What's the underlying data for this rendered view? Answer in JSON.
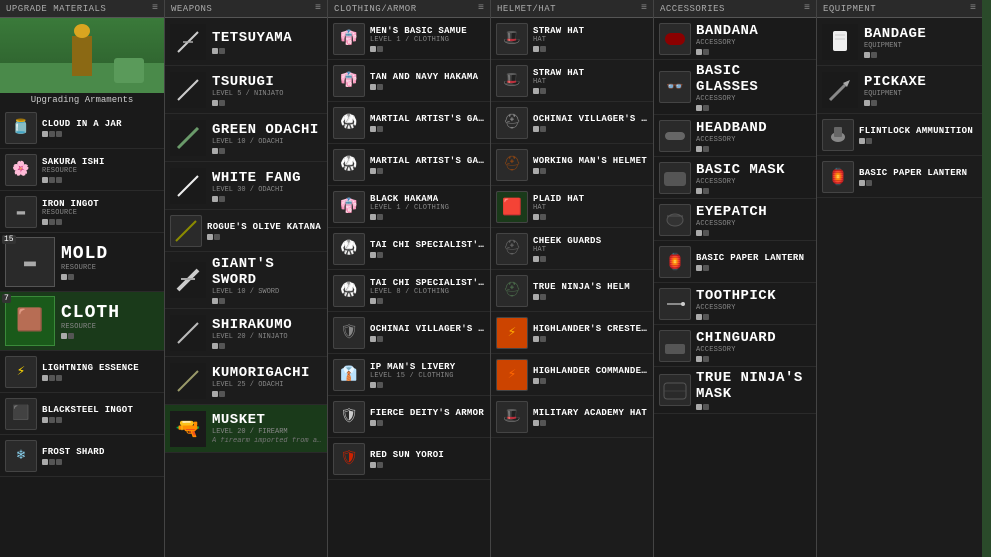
{
  "columns": {
    "upgrade": {
      "header": "UPGRADE MATERIALS",
      "preview_label": "Upgrading Armaments",
      "items": [
        {
          "name": "CLOUD IN A JAR",
          "sub": "",
          "icon": "🫙",
          "stars": 2,
          "num": "",
          "color": "ico-jar"
        },
        {
          "name": "SAKURA ISHI",
          "sub": "RESOURCE",
          "icon": "🌸",
          "stars": 2,
          "num": "",
          "color": "ico-sakura"
        },
        {
          "name": "IRON INGOT",
          "sub": "RESOURCE",
          "icon": "⬛",
          "stars": 2,
          "num": "",
          "color": "ico-iron"
        },
        {
          "name": "MOLD",
          "sub": "RESOURCE",
          "icon": "▬",
          "stars": 2,
          "num": "15",
          "color": "ico-mold",
          "big": true
        },
        {
          "name": "CLOTH",
          "sub": "RESOURCE",
          "icon": "🟫",
          "stars": 2,
          "num": "7",
          "color": "ico-cloth",
          "big": true
        },
        {
          "name": "LIGHTNING ESSENCE",
          "sub": "",
          "icon": "⚡",
          "stars": 2,
          "num": "",
          "color": "ico-lightning"
        },
        {
          "name": "BLACKSTEEL INGOT",
          "sub": "",
          "icon": "⬛",
          "stars": 2,
          "num": "",
          "color": "ico-blacksteel"
        },
        {
          "name": "FROST SHARD",
          "sub": "",
          "icon": "❄",
          "stars": 2,
          "num": "",
          "color": "ico-frost"
        }
      ]
    },
    "weapons": {
      "header": "WEAPONS",
      "items": [
        {
          "name": "TETSUYAMA",
          "sub": "",
          "level": "",
          "icon": "⚔",
          "stars": 2
        },
        {
          "name": "TSURUGI",
          "sub": "LEVEL 5 / NINJATO",
          "icon": "⚔",
          "stars": 2
        },
        {
          "name": "GREEN ODACHI",
          "sub": "LEVEL 10 / ODACHI",
          "icon": "🗡",
          "stars": 2
        },
        {
          "name": "WHITE FANG",
          "sub": "LEVEL 30 / ODACHI",
          "icon": "⚔",
          "stars": 2
        },
        {
          "name": "ROGUE'S OLIVE KATANA",
          "sub": "",
          "icon": "🗡",
          "stars": 2
        },
        {
          "name": "GIANT'S SWORD",
          "sub": "LEVEL 10 / SWORD",
          "icon": "⚔",
          "stars": 2
        },
        {
          "name": "SHIRAKUMO",
          "sub": "LEVEL 20 / NINJATO",
          "icon": "⚔",
          "stars": 2
        },
        {
          "name": "KUMORIGACHI",
          "sub": "LEVEL 25 / ODACHI",
          "icon": "⚔",
          "stars": 2
        },
        {
          "name": "MUSKET",
          "sub": "LEVEL 20 / FIREARM",
          "desc": "A firearm imported from a far away land.",
          "icon": "🔫",
          "stars": 2,
          "green": true
        }
      ]
    },
    "clothing": {
      "header": "CLOTHING/ARMOR",
      "items": [
        {
          "name": "MEN'S BASIC SAMUE",
          "sub": "LEVEL 1 / CLOTHING",
          "icon": "👘",
          "stars": 2
        },
        {
          "name": "TAN AND NAVY HAKAMA",
          "sub": "",
          "icon": "👘",
          "stars": 2
        },
        {
          "name": "MARTIAL ARTIST'S GARB(BLACK)",
          "sub": "",
          "icon": "🥋",
          "stars": 2
        },
        {
          "name": "MARTIAL ARTIST'S GARB(NAVY)",
          "sub": "",
          "icon": "🥋",
          "stars": 2
        },
        {
          "name": "BLACK HAKAMA",
          "sub": "LEVEL 1 / CLOTHING",
          "icon": "👘",
          "stars": 2
        },
        {
          "name": "TAI CHI SPECIALIST'S JACKET",
          "sub": "",
          "icon": "🥋",
          "stars": 2
        },
        {
          "name": "TAI CHI SPECIALIST'S JACKET(BLACK)",
          "sub": "LEVEL 8 / CLOTHING",
          "icon": "🥋",
          "stars": 2
        },
        {
          "name": "OCHINAI VILLAGER'S ARMOR",
          "sub": "",
          "icon": "🛡",
          "stars": 2
        },
        {
          "name": "IP MAN'S LIVERY",
          "sub": "LEVEL 15 / CLOTHING",
          "icon": "👔",
          "stars": 2
        },
        {
          "name": "FIERCE DEITY'S ARMOR",
          "sub": "",
          "icon": "🛡",
          "stars": 2
        },
        {
          "name": "RED SUN YOROI",
          "sub": "",
          "icon": "🛡",
          "stars": 2
        }
      ]
    },
    "helmet": {
      "header": "HELMET/HAT",
      "items": [
        {
          "name": "STRAW HAT",
          "sub": "HAT",
          "icon": "🎩",
          "stars": 2
        },
        {
          "name": "STRAW HAT",
          "sub": "HAT",
          "icon": "🎩",
          "stars": 2
        },
        {
          "name": "OCHINAI VILLAGER'S HELMET",
          "sub": "",
          "icon": "⛑",
          "stars": 2
        },
        {
          "name": "WORKING MAN'S HELMET",
          "sub": "",
          "icon": "⛑",
          "stars": 2
        },
        {
          "name": "PLAID HAT",
          "sub": "HAT",
          "icon": "🎩",
          "stars": 2
        },
        {
          "name": "CHEEK GUARDS",
          "sub": "HAT",
          "icon": "⛑",
          "stars": 2
        },
        {
          "name": "TRUE NINJA'S HELM",
          "sub": "",
          "icon": "⛑",
          "stars": 2
        },
        {
          "name": "HIGHLANDER'S CRESTED HELM",
          "sub": "",
          "icon": "⛑",
          "stars": 2
        },
        {
          "name": "HIGHLANDER COMMANDER'S CRESTED HELM",
          "sub": "",
          "icon": "⛑",
          "stars": 2
        },
        {
          "name": "MILITARY ACADEMY HAT",
          "sub": "",
          "icon": "🎩",
          "stars": 2
        }
      ]
    },
    "accessories": {
      "header": "ACCESSORIES",
      "items": [
        {
          "name": "BANDANA",
          "sub": "ACCESSORY",
          "icon": "🎀",
          "stars": 2
        },
        {
          "name": "BASIC GLASSES",
          "sub": "ACCESSORY",
          "icon": "👓",
          "stars": 2
        },
        {
          "name": "HEADBAND",
          "sub": "ACCESSORY",
          "icon": "🎀",
          "stars": 2
        },
        {
          "name": "BASIC MASK",
          "sub": "ACCESSORY",
          "icon": "😷",
          "stars": 2
        },
        {
          "name": "EYEPATCH",
          "sub": "ACCESSORY",
          "icon": "🏴",
          "stars": 2
        },
        {
          "name": "BASIC PAPER LANTERN",
          "sub": "",
          "icon": "🏮",
          "stars": 2
        },
        {
          "name": "TOOTHPICK",
          "sub": "ACCESSORY",
          "icon": "✏",
          "stars": 2
        },
        {
          "name": "CHINGUARD",
          "sub": "ACCESSORY",
          "icon": "🛡",
          "stars": 2
        },
        {
          "name": "TRUE NINJA'S MASK",
          "sub": "",
          "icon": "😷",
          "stars": 2
        }
      ]
    },
    "equipment": {
      "header": "EQUIPMENT",
      "items": [
        {
          "name": "BANDAGE",
          "sub": "EQUIPMENT",
          "icon": "🩹",
          "stars": 2
        },
        {
          "name": "PICKAXE",
          "sub": "EQUIPMENT",
          "icon": "⛏",
          "stars": 2
        },
        {
          "name": "FLINTLOCK AMMUNITION",
          "sub": "",
          "icon": "🔫",
          "stars": 2
        },
        {
          "name": "BASIC PAPER LANTERN",
          "sub": "",
          "icon": "🏮",
          "stars": 2
        }
      ]
    }
  }
}
